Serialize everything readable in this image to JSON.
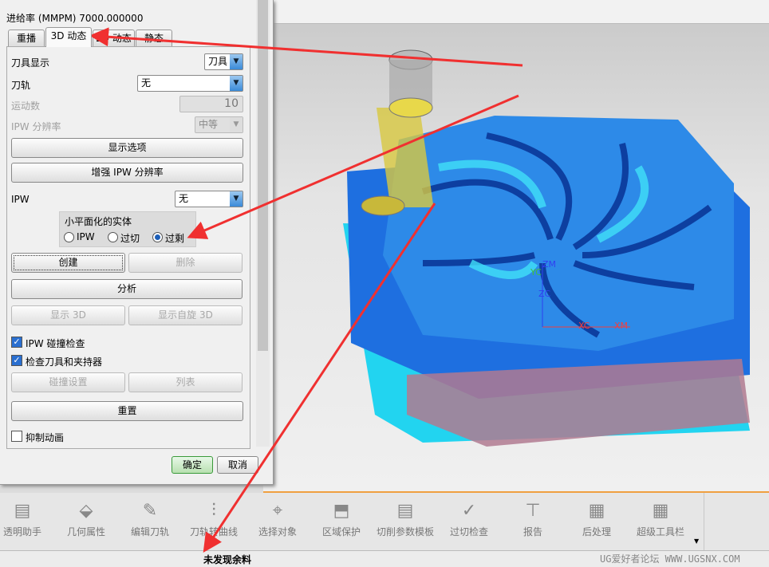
{
  "dialog": {
    "feedrate_label": "进给率 (MMPM) 7000.000000",
    "tabs": [
      "重播",
      "3D 动态",
      "2D 动态",
      "静态"
    ],
    "tool_display_label": "刀具显示",
    "tool_display_value": "刀具",
    "toolpath_label": "刀轨",
    "toolpath_value": "无",
    "motions_label": "运动数",
    "motions_value": "10",
    "ipw_resolution_label": "IPW 分辨率",
    "ipw_resolution_value": "中等",
    "display_options_button": "显示选项",
    "refine_ipw_button": "增强 IPW 分辨率",
    "ipw_label": "IPW",
    "ipw_value": "无",
    "faceted_group_label": "小平面化的实体",
    "radio_ipw": "IPW",
    "radio_undercut": "过切",
    "radio_overcut": "过剩",
    "create_button": "创建",
    "delete_button": "删除",
    "analyze_button": "分析",
    "show_3d_button": "显示 3D",
    "show_spin_3d_button": "显示自旋 3D",
    "ipw_collision_check": "IPW 碰撞检查",
    "check_tool_holder": "检查刀具和夹持器",
    "collision_settings_button": "碰撞设置",
    "list_button": "列表",
    "reset_button": "重置",
    "suppress_animation": "抑制动画",
    "ok_button": "确定",
    "cancel_button": "取消"
  },
  "viewport": {
    "axis_labels": [
      "ZM",
      "YC",
      "ZC",
      "XC",
      "XM"
    ]
  },
  "toolbar": {
    "items": [
      "透明助手",
      "几何属性",
      "编辑刀轨",
      "刀轨转曲线",
      "选择对象",
      "区域保护",
      "切削参数模板",
      "过切检查",
      "报告",
      "后处理",
      "超级工具栏"
    ]
  },
  "status": {
    "message": "未发现余料",
    "watermark": "UG爱好者论坛 WWW.UGSNX.COM"
  },
  "colors": {
    "model": "#1e6fe0",
    "highlight": "#22d4f0",
    "arrow": "#f03030",
    "tool": "#e0d040"
  }
}
